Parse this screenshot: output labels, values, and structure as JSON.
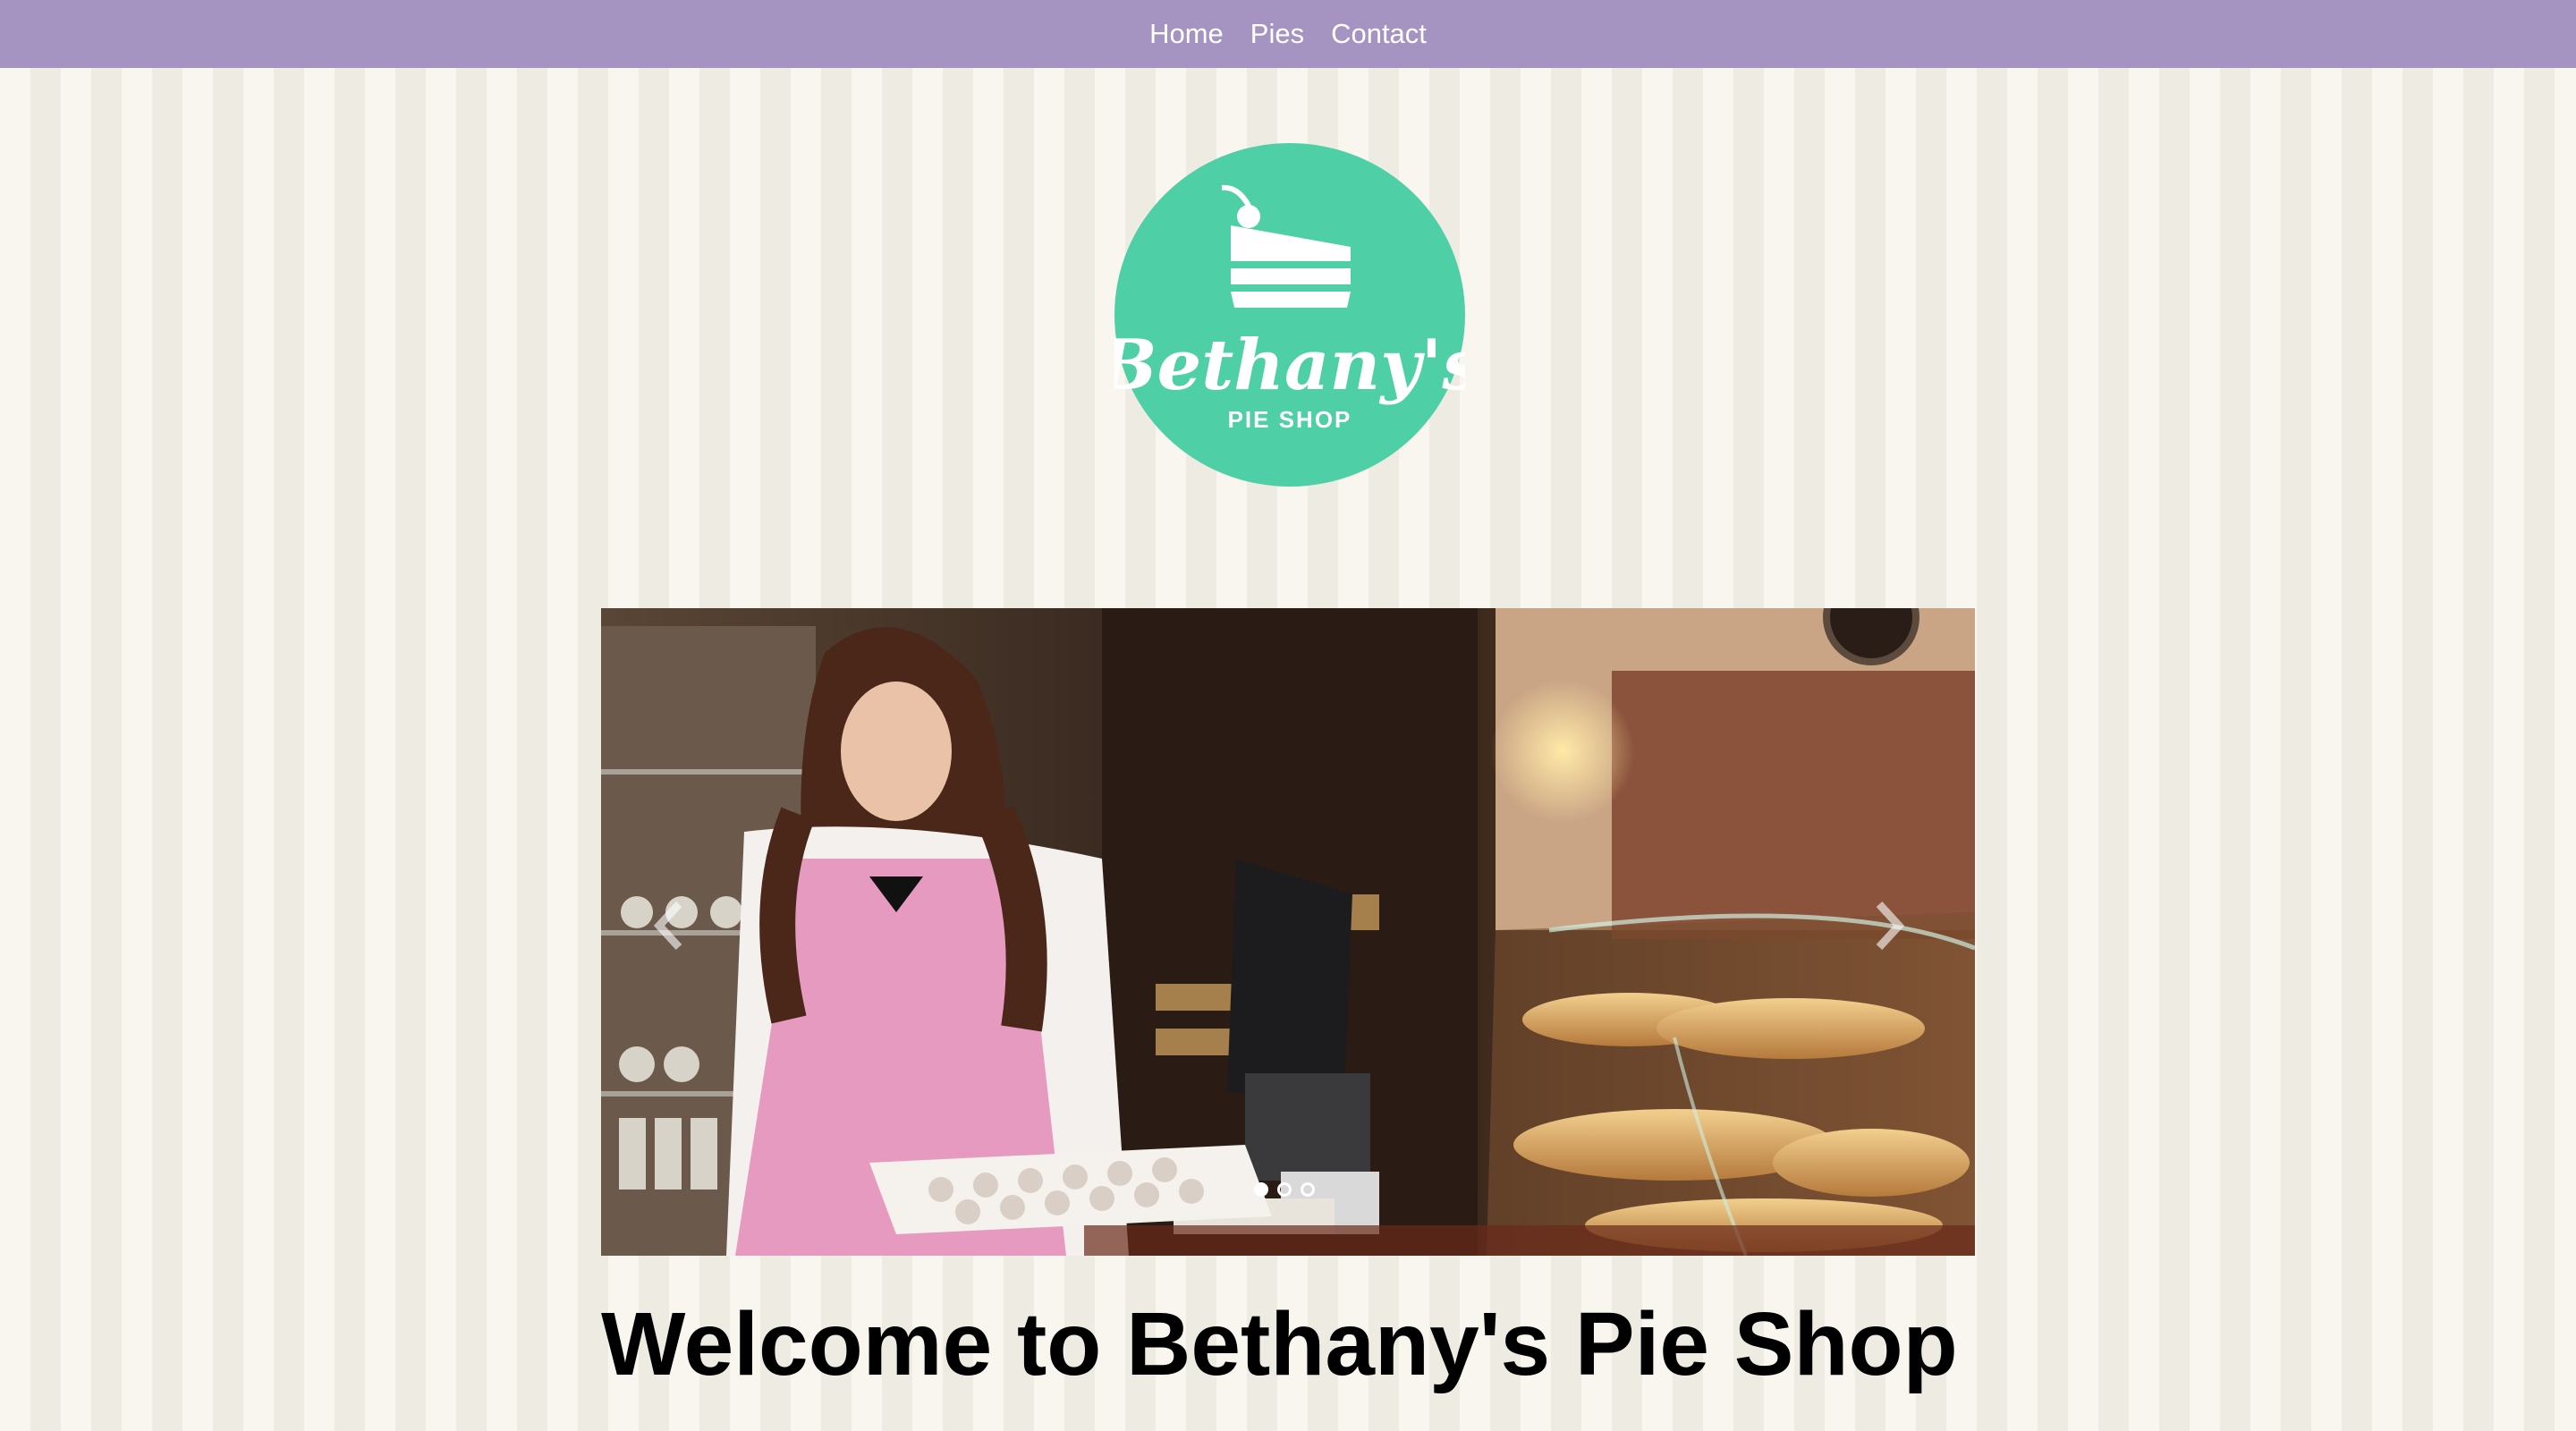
{
  "nav": {
    "items": [
      {
        "label": "Home"
      },
      {
        "label": "Pies"
      },
      {
        "label": "Contact"
      }
    ]
  },
  "logo": {
    "title": "Bethany's",
    "subtitle": "PIE SHOP",
    "color": "#4fcfa6"
  },
  "carousel": {
    "slide_count": 3,
    "active_index": 0,
    "slide_description_icon": "bakery-photo"
  },
  "main": {
    "heading": "Welcome to Bethany's Pie Shop"
  },
  "colors": {
    "navbar": "#a593c2",
    "stripe_light": "#f9f6f0",
    "stripe_dark": "#eeebe2",
    "logo_green": "#4fcfa6"
  }
}
